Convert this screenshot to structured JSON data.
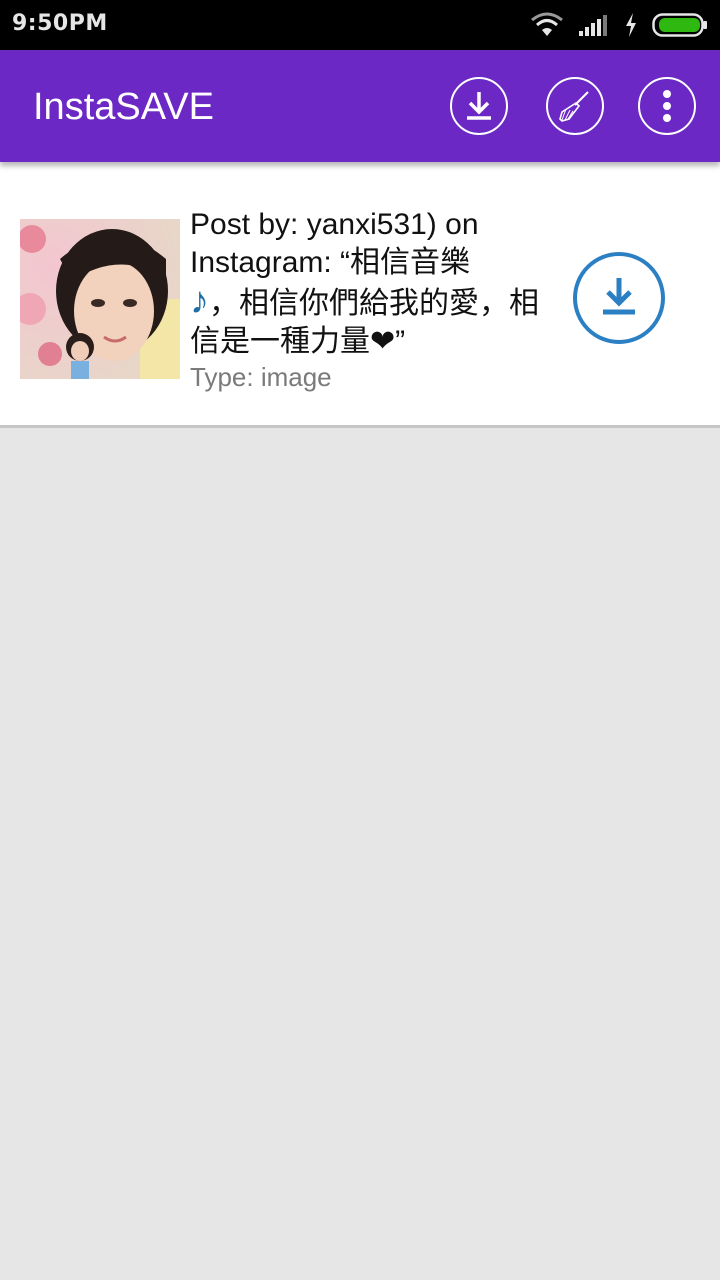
{
  "status_bar": {
    "time": "9:50PM",
    "icons": [
      "wifi-icon",
      "signal-icon",
      "charging-icon",
      "battery-icon"
    ],
    "battery_color": "#2fb80f"
  },
  "app_bar": {
    "title": "InstaSAVE",
    "background": "#6c28c4",
    "actions": [
      "download-icon",
      "broom-icon",
      "more-vert-icon"
    ]
  },
  "posts": [
    {
      "caption_prefix": "Post by: yanxi531) on Instagram: “相信音樂",
      "caption_emoji": "♪",
      "caption_suffix": "，相信你們給我的愛，相信是一種力量❤”",
      "type_label": "Type: image",
      "download_color": "#2b7fc3"
    }
  ]
}
